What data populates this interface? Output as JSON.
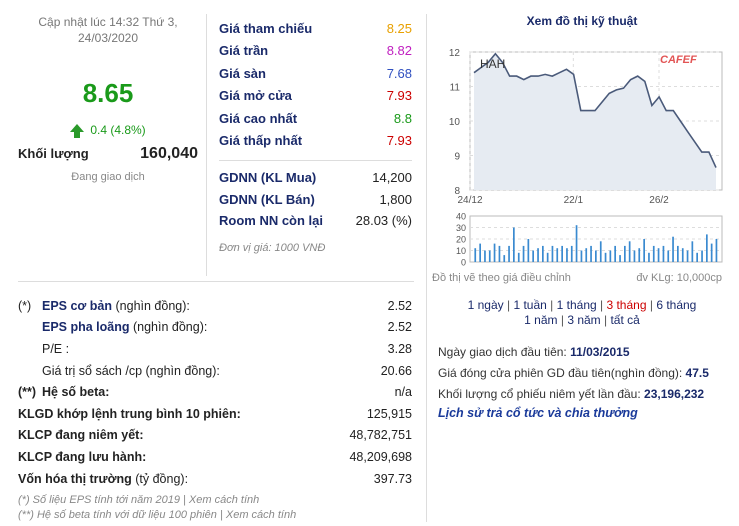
{
  "summary": {
    "updated": "Cập nhật lúc 14:32 Thứ 3, 24/03/2020",
    "price": "8.65",
    "change": "0.4 (4.8%)",
    "volume_label": "Khối lượng",
    "volume_value": "160,040",
    "status": "Đang giao dịch"
  },
  "prices": [
    {
      "label": "Giá tham chiếu",
      "value": "8.25",
      "color": "#e8a000"
    },
    {
      "label": "Giá trần",
      "value": "8.82",
      "color": "#c020c0"
    },
    {
      "label": "Giá sàn",
      "value": "7.68",
      "color": "#3050c0"
    },
    {
      "label": "Giá mở cửa",
      "value": "7.93",
      "color": "#cc0000"
    },
    {
      "label": "Giá cao nhất",
      "value": "8.8",
      "color": "#1a9a1a"
    },
    {
      "label": "Giá thấp nhất",
      "value": "7.93",
      "color": "#cc0000"
    }
  ],
  "foreign": [
    {
      "label": "GDNN (KL Mua)",
      "value": "14,200"
    },
    {
      "label": "GDNN (KL Bán)",
      "value": "1,800"
    },
    {
      "label": "Room NN còn lại",
      "value": "28.03 (%)"
    }
  ],
  "unit_note": "Đơn vị giá: 1000 VNĐ",
  "financials": {
    "eps_basic": {
      "mark": "(*)",
      "label": "EPS cơ bản",
      "suffix": " (nghìn đồng):",
      "value": "2.52"
    },
    "eps_diluted": {
      "label": "EPS pha loãng",
      "suffix": " (nghìn đồng):",
      "value": "2.52"
    },
    "pe": {
      "label": "P/E :",
      "value": "3.28"
    },
    "book_value": {
      "label": "Giá trị sổ sách /cp",
      "suffix": " (nghìn đồng):",
      "value": "20.66"
    },
    "beta": {
      "mark": "(**)",
      "label": "Hệ số beta:",
      "value": "n/a"
    },
    "avg_vol": {
      "label": "KLGD khớp lệnh trung bình 10 phiên:",
      "value": "125,915"
    },
    "listed": {
      "label": "KLCP đang niêm yết:",
      "value": "48,782,751"
    },
    "outstanding": {
      "label": "KLCP đang lưu hành:",
      "value": "48,209,698"
    },
    "mcap": {
      "label": "Vốn hóa thị trường",
      "suffix": " (tỷ đồng):",
      "value": "397.73"
    }
  },
  "notes": {
    "eps": "(*) Số liệu EPS tính tới năm 2019 | Xem cách tính",
    "beta": "(**) Hệ số beta tính với dữ liệu 100 phiên | Xem cách tính"
  },
  "chart": {
    "title": "Xem đồ thị kỹ thuật",
    "ticker": "HAH",
    "brand": "CAFEF",
    "adjusted_note": "Đồ thị vẽ theo giá điều chỉnh",
    "vol_unit": "đv KLg: 10,000cp",
    "range_row1": [
      "1 ngày",
      "1 tuần",
      "1 tháng",
      "3 tháng",
      "6 tháng"
    ],
    "range_row2": [
      "1 năm",
      "3 năm",
      "tất cả"
    ],
    "selected_range": "3 tháng"
  },
  "chart_data": {
    "type": "line",
    "x_ticks": [
      "24/12",
      "22/1",
      "26/2"
    ],
    "y_ticks": [
      12,
      11,
      10,
      9,
      8
    ],
    "ylim": [
      8,
      12
    ],
    "price": [
      11.4,
      11.55,
      11.7,
      11.95,
      11.7,
      11.3,
      11.3,
      11.2,
      11.3,
      11.3,
      11.35,
      11.3,
      11.4,
      11.5,
      11.35,
      10.3,
      10.3,
      10.3,
      10.55,
      10.8,
      10.9,
      10.95,
      11.2,
      11.3,
      11.15,
      10.45,
      10.7,
      10.3,
      10.3,
      10.0,
      9.7,
      9.4,
      9.1,
      9.1,
      8.65
    ],
    "vol_ticks": [
      40,
      30,
      20,
      10,
      0
    ],
    "vol_ylim": [
      0,
      40
    ],
    "volume": [
      12,
      16,
      10,
      10,
      16,
      14,
      6,
      14,
      30,
      8,
      14,
      20,
      10,
      12,
      14,
      8,
      14,
      12,
      14,
      12,
      14,
      32,
      10,
      12,
      14,
      10,
      18,
      8,
      10,
      14,
      6,
      14,
      18,
      10,
      12,
      20,
      8,
      14,
      12,
      14,
      10,
      22,
      14,
      12,
      10,
      18,
      8,
      10,
      24,
      16,
      20
    ]
  },
  "listing": {
    "first_day_label": "Ngày giao dịch đầu tiên:",
    "first_day_value": "11/03/2015",
    "first_close_label": "Giá đóng cửa phiên GD đầu tiên(nghìn đồng):",
    "first_close_value": "47.5",
    "first_vol_label": "Khối lượng cổ phiếu niêm yết lần đầu:",
    "first_vol_value": "23,196,232",
    "history_link": "Lịch sử trả cổ tức và chia thưởng"
  },
  "colors": {
    "up": "#1a9a1a",
    "label_blue": "#1a2a6a",
    "chart_line": "#4a5a7a",
    "volume_bar": "#3a8ad0"
  }
}
